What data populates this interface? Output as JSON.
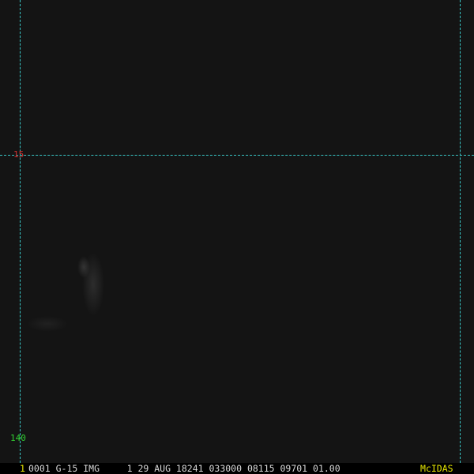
{
  "image": {
    "satellite": "G-15",
    "product": "IMG",
    "description": "Dark satellite image with lat/lon grid overlay"
  },
  "grid": {
    "latitude_label": "15",
    "longitude_label": "140",
    "line_color": "#38c6c6",
    "latitude_label_color": "#d23030",
    "longitude_label_color": "#32d232"
  },
  "status_bar": {
    "frame_number": "1",
    "info_text": "0001 G-15 IMG     1 29 AUG 18241 033000 08115 09701 01.00",
    "brand": "McIDAS",
    "frame_number_color": "#e6e600",
    "brand_color": "#e6e600",
    "info_color": "#d8d8d8"
  },
  "colors": {
    "background": "#141414",
    "status_bar_background": "#000000"
  }
}
